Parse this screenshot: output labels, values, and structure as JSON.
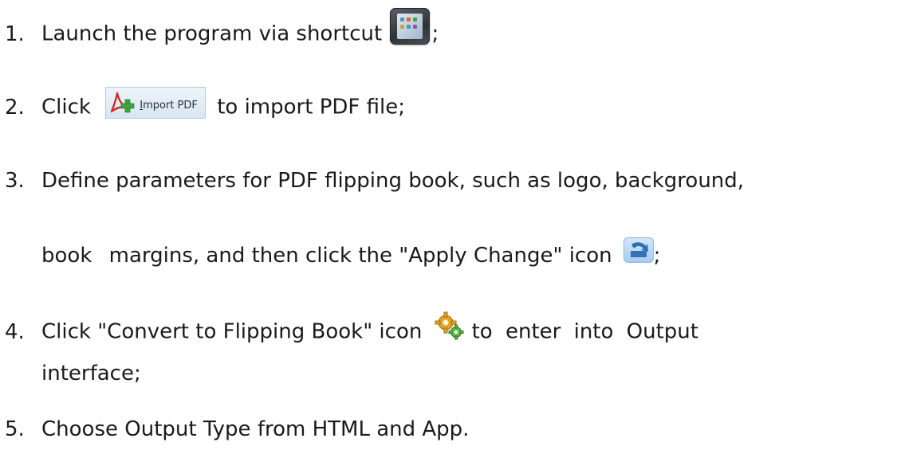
{
  "steps": [
    {
      "num": "1.",
      "before": "Launch the program via shortcut",
      "after": ";",
      "icon": "tablet-icon"
    },
    {
      "num": "2.",
      "before": "Click",
      "after": "to import PDF file;",
      "icon": "import-pdf-button",
      "button_label_u": "I",
      "button_label_rest": "mport PDF"
    },
    {
      "num": "3.",
      "line1": "Define parameters for PDF flipping book, such as logo, background,",
      "line2_before": "book  margins, and then click the \"Apply Change\" icon",
      "after": ";",
      "icon": "apply-change-icon"
    },
    {
      "num": "4.",
      "line1_before": "Click \"Convert to Flipping Book\" icon",
      "line1_after": "to enter into Output",
      "line2": "interface;",
      "icon": "gear-icon"
    },
    {
      "num": "5.",
      "text": "Choose Output Type from HTML and App."
    }
  ],
  "colors": {
    "text": "#1a1a1a",
    "accent": "#2f6fb4"
  }
}
